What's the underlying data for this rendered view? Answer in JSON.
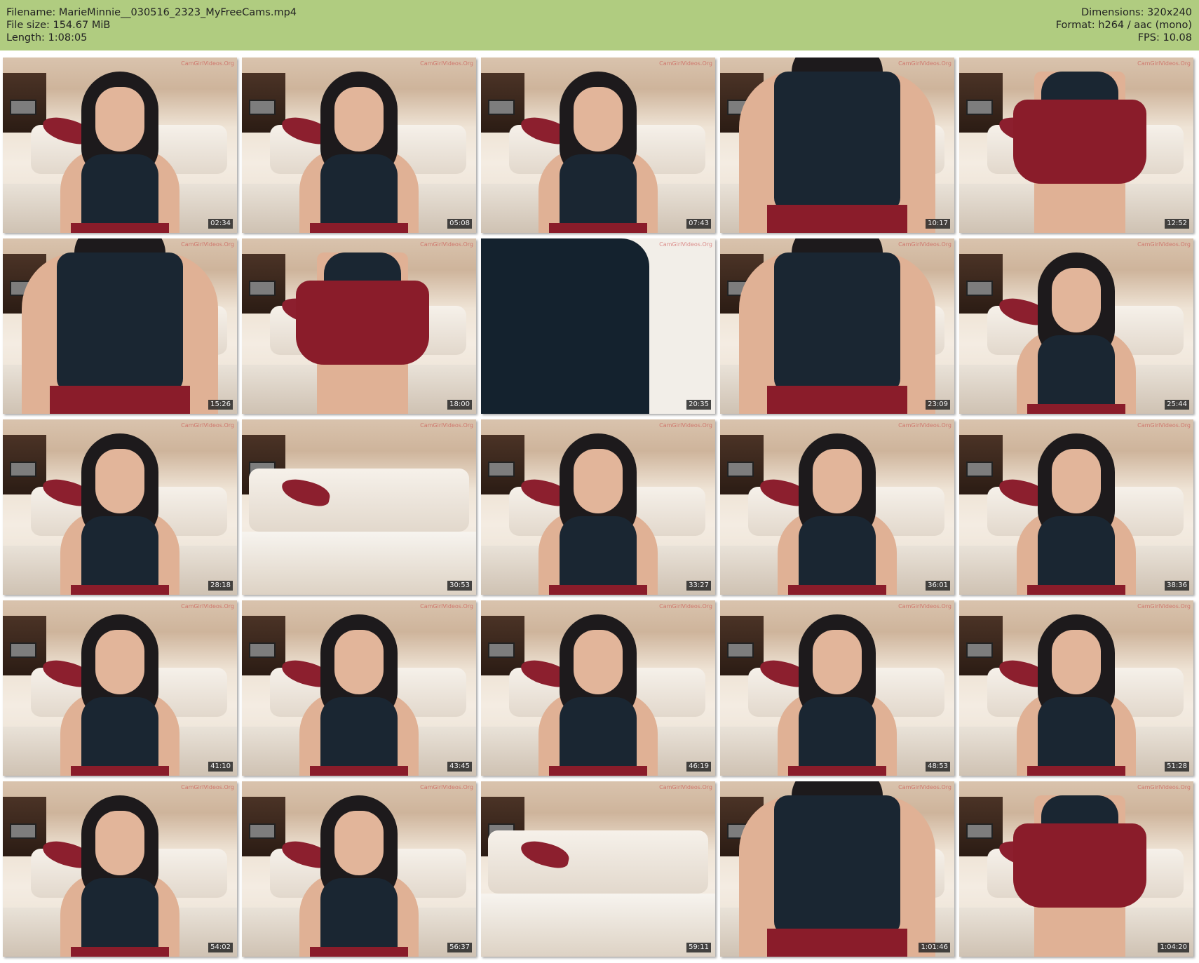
{
  "header": {
    "left": [
      "Filename: MarieMinnie__030516_2323_MyFreeCams.mp4",
      "File size: 154.67 MiB",
      "Length: 1:08:05"
    ],
    "right": [
      "Dimensions: 320x240",
      "Format: h264 / aac (mono)",
      "FPS: 10.08"
    ]
  },
  "thumbnails": [
    {
      "time": "02:34",
      "scene": "portrait"
    },
    {
      "time": "05:08",
      "scene": "portrait"
    },
    {
      "time": "07:43",
      "scene": "portrait"
    },
    {
      "time": "10:17",
      "scene": "close"
    },
    {
      "time": "12:52",
      "scene": "skirt"
    },
    {
      "time": "15:26",
      "scene": "close"
    },
    {
      "time": "18:00",
      "scene": "skirt"
    },
    {
      "time": "20:35",
      "scene": "fabric"
    },
    {
      "time": "23:09",
      "scene": "close"
    },
    {
      "time": "25:44",
      "scene": "portrait"
    },
    {
      "time": "28:18",
      "scene": "portrait"
    },
    {
      "time": "30:53",
      "scene": "empty"
    },
    {
      "time": "33:27",
      "scene": "portrait"
    },
    {
      "time": "36:01",
      "scene": "portrait"
    },
    {
      "time": "38:36",
      "scene": "portrait"
    },
    {
      "time": "41:10",
      "scene": "portrait"
    },
    {
      "time": "43:45",
      "scene": "portrait"
    },
    {
      "time": "46:19",
      "scene": "portrait"
    },
    {
      "time": "48:53",
      "scene": "portrait"
    },
    {
      "time": "51:28",
      "scene": "portrait"
    },
    {
      "time": "54:02",
      "scene": "portrait"
    },
    {
      "time": "56:37",
      "scene": "portrait"
    },
    {
      "time": "59:11",
      "scene": "empty"
    },
    {
      "time": "1:01:46",
      "scene": "close"
    },
    {
      "time": "1:04:20",
      "scene": "skirt"
    }
  ],
  "watermark": "CamGirlVideos.Org",
  "colors": {
    "header_bg": "#b0cc80",
    "timestamp_bg": "#282828"
  }
}
